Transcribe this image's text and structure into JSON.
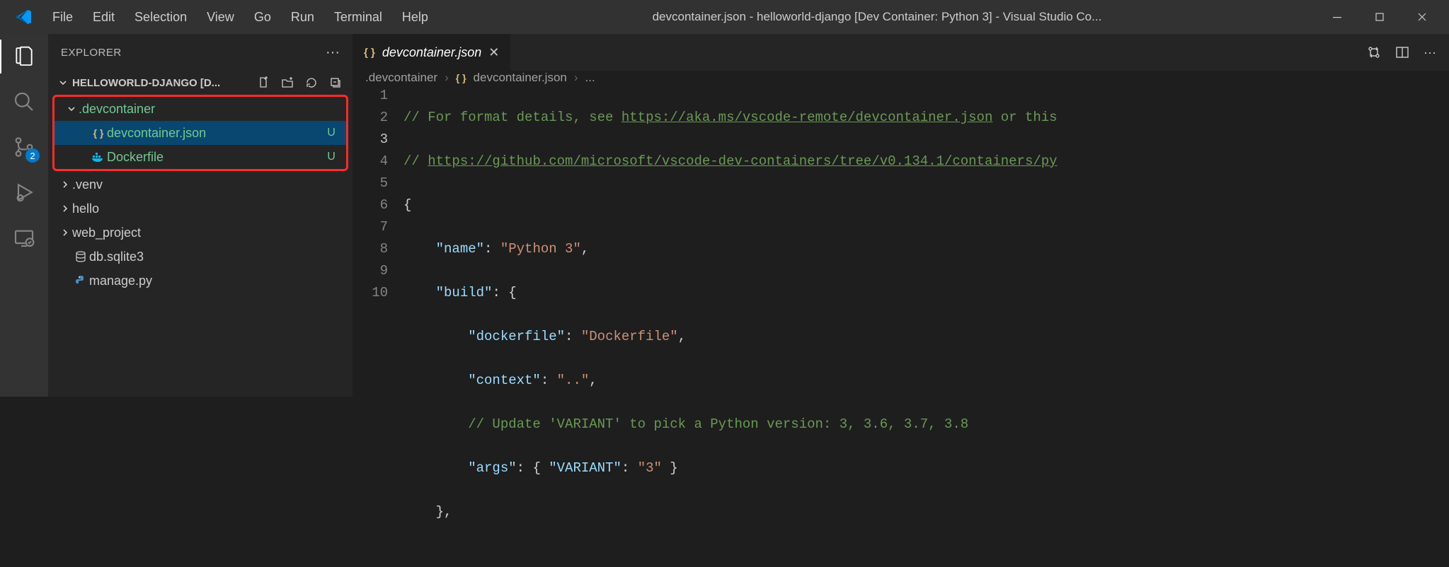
{
  "window": {
    "title": "devcontainer.json - helloworld-django [Dev Container: Python 3] - Visual Studio Co..."
  },
  "menubar": [
    "File",
    "Edit",
    "Selection",
    "View",
    "Go",
    "Run",
    "Terminal",
    "Help"
  ],
  "activity": {
    "scm_badge": "2"
  },
  "explorer": {
    "title": "EXPLORER",
    "section": "HELLOWORLD-DJANGO [D...",
    "tree": {
      "devcontainer_folder": ".devcontainer",
      "devcontainer_json": "devcontainer.json",
      "devcontainer_json_status": "U",
      "dockerfile": "Dockerfile",
      "dockerfile_status": "U",
      "venv": ".venv",
      "hello": "hello",
      "web_project": "web_project",
      "db": "db.sqlite3",
      "manage": "manage.py"
    }
  },
  "tab": {
    "label": "devcontainer.json"
  },
  "breadcrumb": {
    "folder": ".devcontainer",
    "file": "devcontainer.json",
    "more": "..."
  },
  "code": {
    "line_numbers": [
      "1",
      "2",
      "3",
      "4",
      "5",
      "6",
      "7",
      "8",
      "9",
      "10"
    ],
    "l1_a": "// For format details, see ",
    "l1_link": "https://aka.ms/vscode-remote/devcontainer.json",
    "l1_b": " or this",
    "l2_a": "// ",
    "l2_link": "https://github.com/microsoft/vscode-dev-containers/tree/v0.134.1/containers/py",
    "l3": "{",
    "l4_key": "\"name\"",
    "l4_val": "\"Python 3\"",
    "l5_key": "\"build\"",
    "l6_key": "\"dockerfile\"",
    "l6_val": "\"Dockerfile\"",
    "l7_key": "\"context\"",
    "l7_val": "\"..\"",
    "l8": "// Update 'VARIANT' to pick a Python version: 3, 3.6, 3.7, 3.8",
    "l9_key": "\"args\"",
    "l9_ikey": "\"VARIANT\"",
    "l9_ival": "\"3\"",
    "l10": "},"
  }
}
